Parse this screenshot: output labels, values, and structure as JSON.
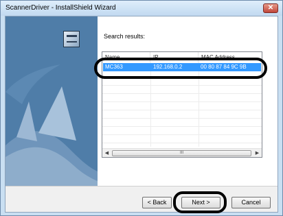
{
  "window": {
    "title": "ScannerDriver - InstallShield Wizard",
    "close_label": "✕"
  },
  "content": {
    "heading": "Search results:"
  },
  "table": {
    "columns": [
      "Name",
      "IP",
      "MAC Address"
    ],
    "rows": [
      {
        "name": "MC363",
        "ip": "192.168.0.2",
        "mac": "00 80 87 84 9C 9B",
        "selected": true
      }
    ]
  },
  "scrollbar": {
    "left_arrow": "◀",
    "right_arrow": "▶",
    "thumb_grip": "III"
  },
  "buttons": {
    "back": "< Back",
    "next": "Next >",
    "cancel": "Cancel"
  },
  "colors": {
    "selection": "#3399ff",
    "wizard_panel": "#4f7da8"
  }
}
